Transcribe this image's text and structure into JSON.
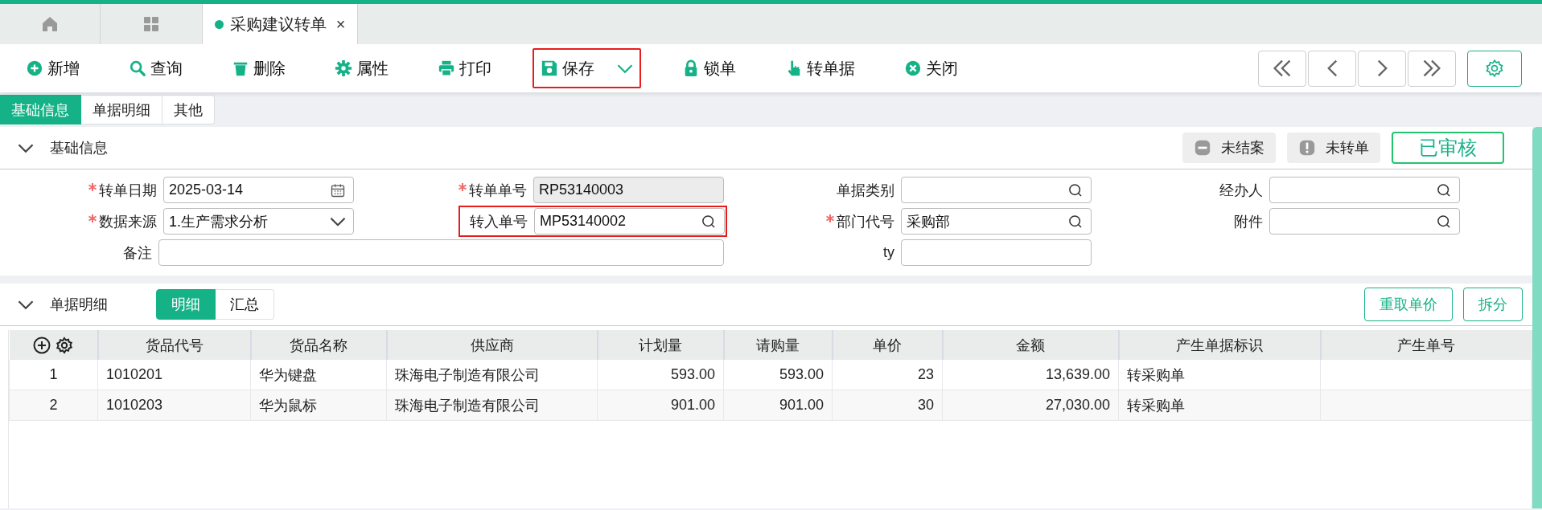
{
  "page_tabs": [
    {
      "kind": "home",
      "selected": false
    },
    {
      "kind": "apps",
      "selected": false
    },
    {
      "kind": "document",
      "label": "采购建议转单",
      "close": "×",
      "selected": true
    }
  ],
  "toolbar": [
    {
      "kind": "plus",
      "label": "新增",
      "highlighted": false,
      "dropdown": false
    },
    {
      "kind": "search",
      "label": "查询",
      "highlighted": false,
      "dropdown": false
    },
    {
      "kind": "trash",
      "label": "删除",
      "highlighted": false,
      "dropdown": false
    },
    {
      "kind": "gear",
      "label": "属性",
      "highlighted": false,
      "dropdown": false
    },
    {
      "kind": "printer",
      "label": "打印",
      "highlighted": false,
      "dropdown": false
    },
    {
      "kind": "floppy",
      "label": "保存",
      "highlighted": true,
      "dropdown": true
    },
    {
      "kind": "lock",
      "label": "锁单",
      "highlighted": false,
      "dropdown": false
    },
    {
      "kind": "hand",
      "label": "转单据",
      "highlighted": false,
      "dropdown": false
    },
    {
      "kind": "close",
      "label": "关闭",
      "highlighted": false,
      "dropdown": false
    }
  ],
  "section_tabs": [
    {
      "label": "基础信息",
      "selected": true
    },
    {
      "label": "单据明细",
      "selected": false
    },
    {
      "label": "其他",
      "selected": false
    }
  ],
  "basic_info": {
    "title": "基础信息",
    "expanded": true,
    "badges": [
      {
        "kind": "minus",
        "label": "未结案"
      },
      {
        "kind": "exclamation",
        "label": "未转单"
      }
    ],
    "status": "已审核",
    "fields": [
      {
        "label": "转单日期",
        "required": true,
        "kind": "date",
        "value": "2025-03-14"
      },
      {
        "label": "转单单号",
        "required": true,
        "kind": "readonly",
        "value": "RP53140003"
      },
      {
        "label": "单据类别",
        "required": false,
        "kind": "lookup"
      },
      {
        "label": "经办人",
        "required": false,
        "kind": "lookup"
      },
      {
        "label": "数据来源",
        "required": true,
        "kind": "select",
        "value": "1.生产需求分析"
      },
      {
        "label": "转入单号",
        "required": false,
        "kind": "lookup",
        "value": "MP53140002",
        "highlighted": true
      },
      {
        "label": "部门代号",
        "required": true,
        "kind": "lookup",
        "value": "采购部"
      },
      {
        "label": "附件",
        "required": false,
        "kind": "lookup"
      },
      {
        "label": "备注",
        "required": false,
        "kind": "text",
        "wide": true
      },
      {
        "label": "ty",
        "required": false,
        "kind": "text"
      }
    ]
  },
  "details": {
    "title": "单据明细",
    "expanded": true,
    "views": [
      {
        "label": "明细",
        "selected": true
      },
      {
        "label": "汇总",
        "selected": false
      }
    ],
    "buttons": [
      "重取单价",
      "拆分"
    ],
    "table": {
      "columns": [
        {
          "label": "货品代号",
          "kind": "text"
        },
        {
          "label": "货品名称",
          "kind": "text"
        },
        {
          "label": "供应商",
          "kind": "text"
        },
        {
          "label": "计划量",
          "kind": "number"
        },
        {
          "label": "请购量",
          "kind": "number"
        },
        {
          "label": "单价",
          "kind": "number"
        },
        {
          "label": "金额",
          "kind": "number"
        },
        {
          "label": "产生单据标识",
          "kind": "text"
        },
        {
          "label": "产生单号",
          "kind": "text"
        }
      ],
      "rows": [
        {
          "index": "1",
          "cells": [
            "1010201",
            "华为键盘",
            "珠海电子制造有限公司",
            "593.00",
            "593.00",
            "23",
            "13,639.00",
            "转采购单"
          ]
        },
        {
          "index": "2",
          "cells": [
            "1010203",
            "华为鼠标",
            "珠海电子制造有限公司",
            "901.00",
            "901.00",
            "30",
            "27,030.00",
            "转采购单"
          ]
        }
      ]
    }
  }
}
